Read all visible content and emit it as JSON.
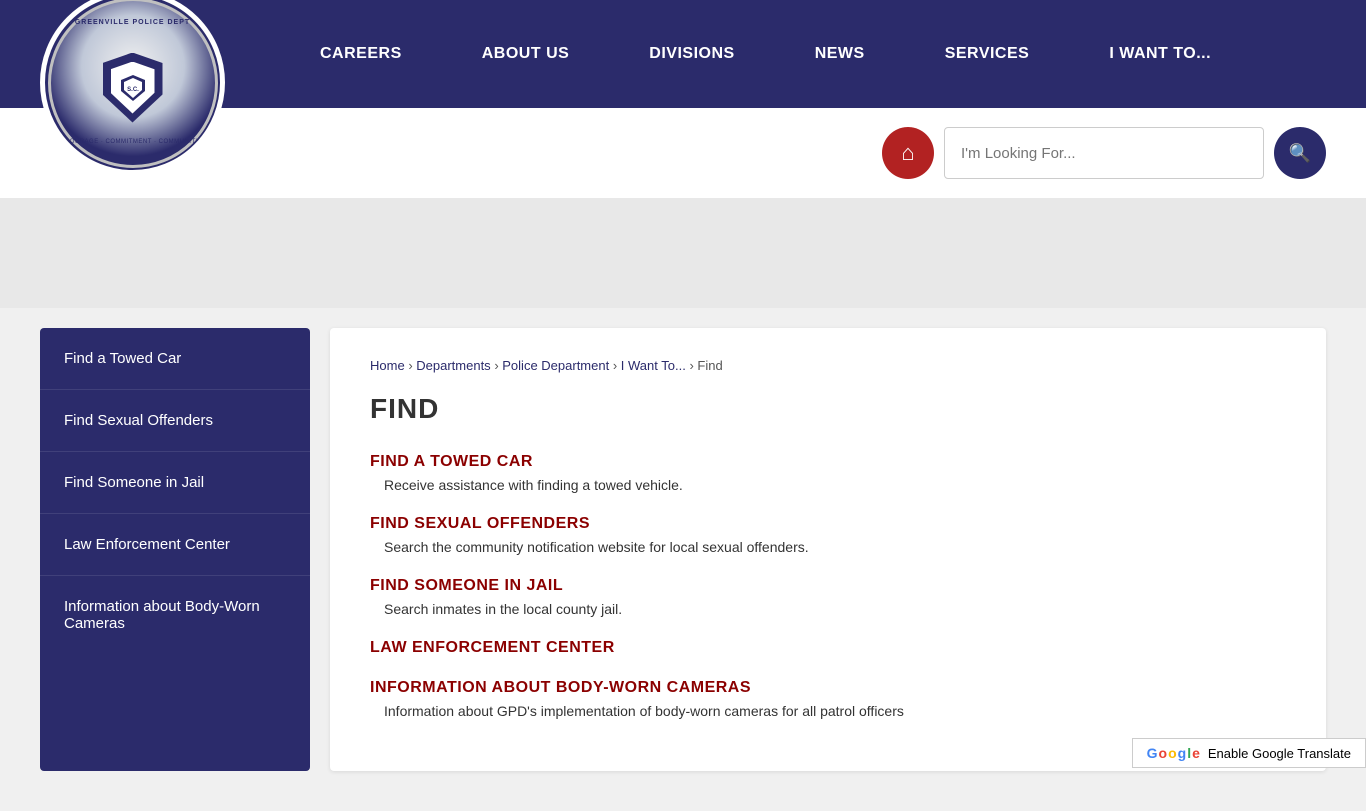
{
  "site": {
    "name": "Greenville Police Department"
  },
  "header": {
    "nav": [
      {
        "label": "CAREERS",
        "id": "careers"
      },
      {
        "label": "ABOUT US",
        "id": "about-us"
      },
      {
        "label": "DIVISIONS",
        "id": "divisions"
      },
      {
        "label": "NEWS",
        "id": "news"
      },
      {
        "label": "SERVICES",
        "id": "services"
      },
      {
        "label": "I WANT TO...",
        "id": "i-want-to"
      }
    ]
  },
  "search": {
    "placeholder": "I'm Looking For...",
    "home_label": "Home"
  },
  "breadcrumb": {
    "items": [
      "Home",
      "Departments",
      "Police Department",
      "I Want To...",
      "Find"
    ]
  },
  "page": {
    "title": "FIND"
  },
  "sidebar": {
    "items": [
      {
        "label": "Find a Towed Car"
      },
      {
        "label": "Find Sexual Offenders"
      },
      {
        "label": "Find Someone in Jail"
      },
      {
        "label": "Law Enforcement Center"
      },
      {
        "label": "Information about Body-Worn Cameras"
      }
    ]
  },
  "sections": [
    {
      "heading": "FIND A TOWED CAR",
      "description": "Receive assistance with finding a towed vehicle."
    },
    {
      "heading": "FIND SEXUAL OFFENDERS",
      "description": "Search the community notification website for local sexual offenders."
    },
    {
      "heading": "FIND SOMEONE IN JAIL",
      "description": "Search inmates in the local county jail."
    },
    {
      "heading": "LAW ENFORCEMENT CENTER",
      "description": ""
    },
    {
      "heading": "INFORMATION ABOUT BODY-WORN CAMERAS",
      "description": "Information about GPD's implementation of body-worn cameras for all patrol officers"
    }
  ],
  "translate": {
    "label": "Enable Google Translate"
  },
  "colors": {
    "navy": "#2b2b6b",
    "darkred": "#8b0000",
    "red": "#b22222"
  }
}
